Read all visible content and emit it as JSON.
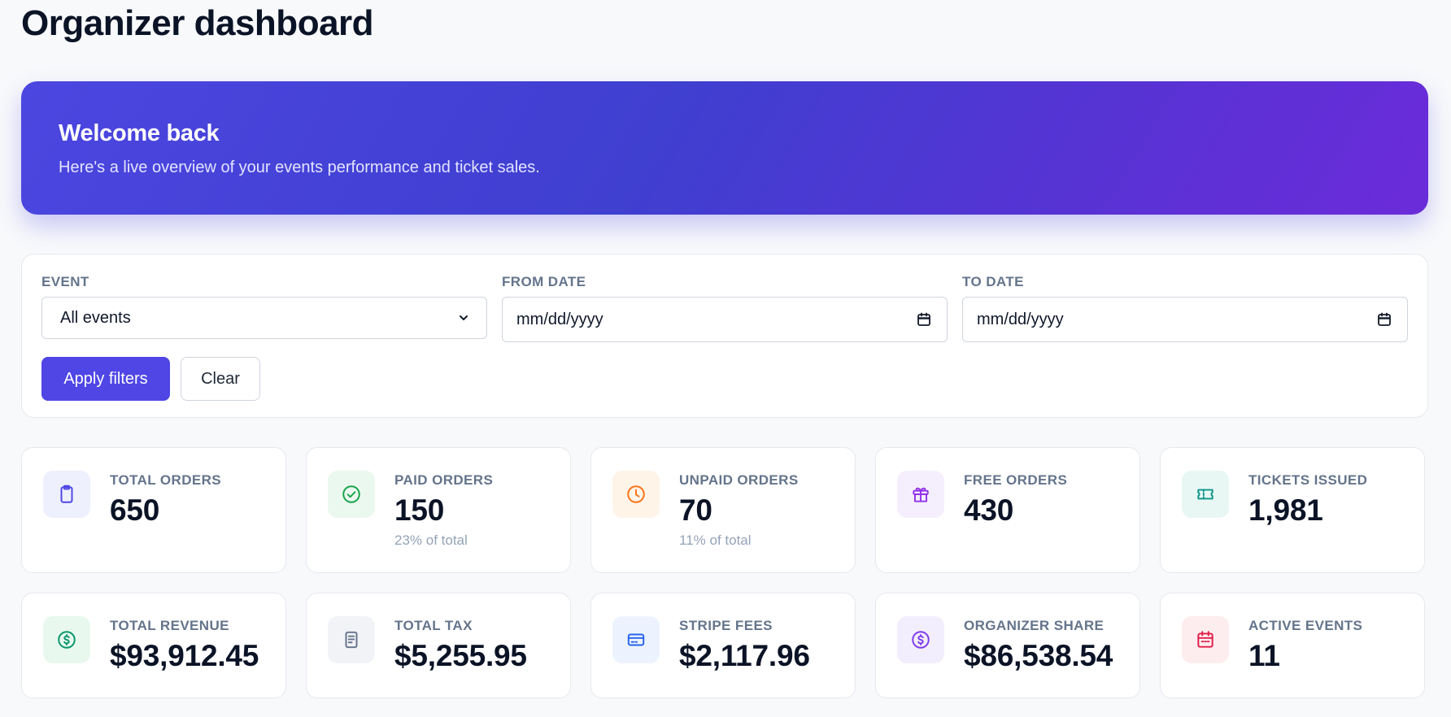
{
  "page": {
    "title": "Organizer dashboard"
  },
  "hero": {
    "title": "Welcome back",
    "subtitle": "Here's a live overview of your events performance and ticket sales."
  },
  "filters": {
    "event_label": "EVENT",
    "event_value": "All events",
    "from_label": "FROM DATE",
    "from_value": "mm/dd/yyyy",
    "to_label": "TO DATE",
    "to_value": "mm/dd/yyyy",
    "apply_label": "Apply filters",
    "clear_label": "Clear"
  },
  "stats": [
    {
      "label": "TOTAL ORDERS",
      "value": "650",
      "sub": "",
      "icon": "clipboard-icon",
      "color": "#4f46e5",
      "bg": "#eef0fd"
    },
    {
      "label": "PAID ORDERS",
      "value": "150",
      "sub": "23% of total",
      "icon": "check-circle-icon",
      "color": "#16a34a",
      "bg": "#ebf8ef"
    },
    {
      "label": "UNPAID ORDERS",
      "value": "70",
      "sub": "11% of total",
      "icon": "clock-icon",
      "color": "#f97316",
      "bg": "#fff4e8"
    },
    {
      "label": "FREE ORDERS",
      "value": "430",
      "sub": "",
      "icon": "gift-icon",
      "color": "#9333ea",
      "bg": "#f5effd"
    },
    {
      "label": "TICKETS ISSUED",
      "value": "1,981",
      "sub": "",
      "icon": "ticket-icon",
      "color": "#0d9488",
      "bg": "#e8f7f4"
    },
    {
      "label": "TOTAL REVENUE",
      "value": "$93,912.45",
      "sub": "",
      "icon": "dollar-circle-icon",
      "color": "#059669",
      "bg": "#e8f8ef"
    },
    {
      "label": "TOTAL TAX",
      "value": "$5,255.95",
      "sub": "",
      "icon": "receipt-icon",
      "color": "#64748b",
      "bg": "#f1f3f6"
    },
    {
      "label": "STRIPE FEES",
      "value": "$2,117.96",
      "sub": "",
      "icon": "credit-card-icon",
      "color": "#2563eb",
      "bg": "#edf3fe"
    },
    {
      "label": "ORGANIZER SHARE",
      "value": "$86,538.54",
      "sub": "",
      "icon": "dollar-circle-icon",
      "color": "#7c3aed",
      "bg": "#f3eefd"
    },
    {
      "label": "ACTIVE EVENTS",
      "value": "11",
      "sub": "",
      "icon": "calendar-icon",
      "color": "#e11d48",
      "bg": "#fdedef"
    }
  ]
}
